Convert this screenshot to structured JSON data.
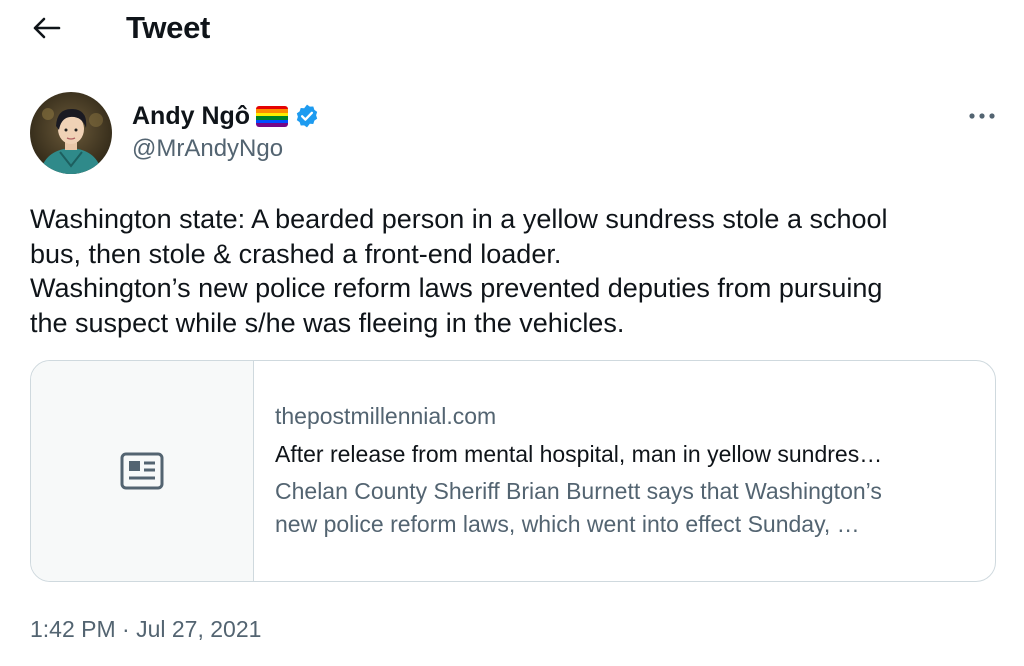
{
  "header": {
    "title": "Tweet",
    "back_icon": "arrow-left-icon"
  },
  "author": {
    "name": "Andy Ngô",
    "handle": "@MrAndyNgo",
    "flag_emoji": "rainbow-flag",
    "verified": true,
    "verified_color": "#1d9bf0"
  },
  "tweet": {
    "lines": [
      "Washington state: A bearded person in a yellow sundress stole a school",
      "bus, then stole & crashed a front-end loader.",
      "Washington’s new police reform laws prevented deputies from pursuing",
      "the suspect while s/he was fleeing in the vehicles."
    ],
    "timestamp": "1:42 PM · Jul 27, 2021"
  },
  "link_card": {
    "icon": "article-icon",
    "domain": "thepostmillennial.com",
    "title": "After release from mental hospital, man in yellow sundres…",
    "description_lines": [
      "Chelan County Sheriff Brian Burnett says that Washington’s",
      "new police reform laws, which went into effect Sunday, …"
    ]
  },
  "colors": {
    "text_primary": "#0f1419",
    "text_secondary": "#536471",
    "border": "#cfd9de",
    "card_media_bg": "#f7f9f9",
    "verified_blue": "#1d9bf0"
  }
}
